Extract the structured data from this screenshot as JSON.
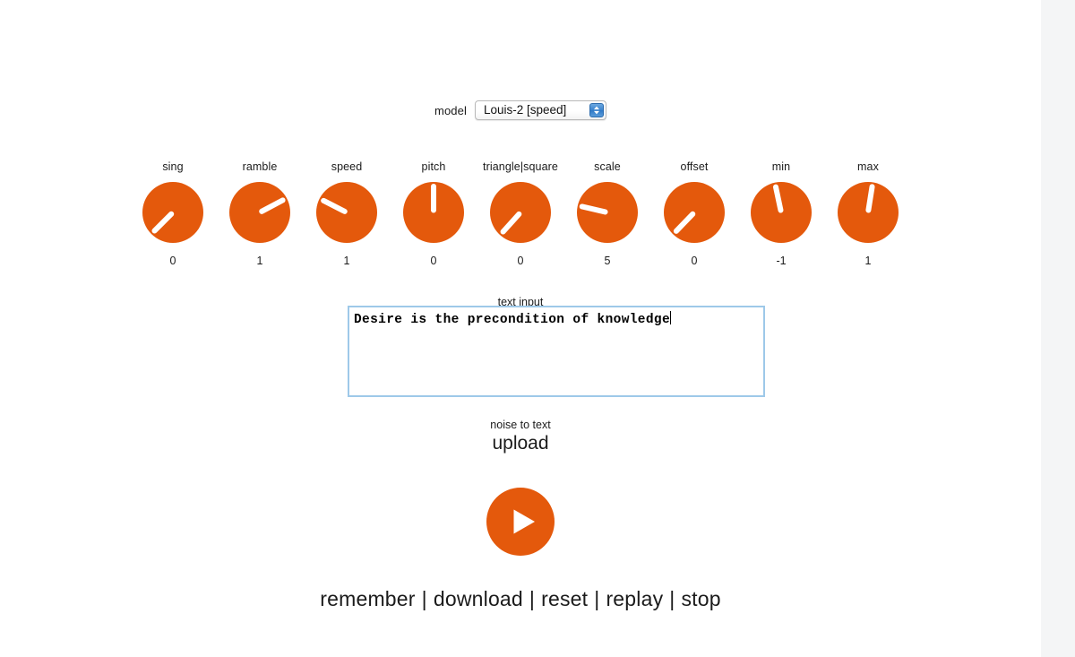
{
  "theme": {
    "accent": "#e4590c",
    "page_bg": "#ffffff",
    "outer_bg": "#f4f5f6",
    "text": "#1b1b1b",
    "focus_border": "#9ec9e9"
  },
  "model": {
    "label": "model",
    "selected": "Louis-2 [speed]",
    "stepper_icon": "chevron-up-down-icon"
  },
  "knobs": [
    {
      "name": "sing",
      "value": "0",
      "angle": 225
    },
    {
      "name": "ramble",
      "value": "1",
      "angle": 62
    },
    {
      "name": "speed",
      "value": "1",
      "angle": 297
    },
    {
      "name": "pitch",
      "value": "0",
      "angle": 0
    },
    {
      "name": "triangle|square",
      "value": "0",
      "angle": 222
    },
    {
      "name": "scale",
      "value": "5",
      "angle": 283
    },
    {
      "name": "offset",
      "value": "0",
      "angle": 224
    },
    {
      "name": "min",
      "value": "-1",
      "angle": 348
    },
    {
      "name": "max",
      "value": "1",
      "angle": 9
    }
  ],
  "text_input": {
    "label": "text input",
    "value": "Desire is the precondition of knowledge",
    "placeholder": ""
  },
  "noise_to_text": {
    "label": "noise to text",
    "upload_label": "upload"
  },
  "transport": {
    "play_icon": "play-icon"
  },
  "actions": {
    "separator": "|",
    "items": [
      {
        "label": "remember"
      },
      {
        "label": "download"
      },
      {
        "label": "reset"
      },
      {
        "label": "replay"
      },
      {
        "label": "stop"
      }
    ]
  }
}
